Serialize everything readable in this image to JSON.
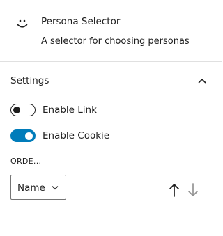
{
  "block": {
    "icon": "smiley-icon",
    "title": "Persona Selector",
    "description": "A selector for choosing personas"
  },
  "settings_panel": {
    "title": "Settings",
    "expanded": true,
    "toggles": [
      {
        "label": "Enable Link",
        "checked": false
      },
      {
        "label": "Enable Cookie",
        "checked": true
      }
    ],
    "order": {
      "label": "ORDE...",
      "selected": "Name"
    },
    "sort_icons": [
      "arrow-up-icon",
      "arrow-down-icon"
    ]
  },
  "colors": {
    "accent": "#007cba",
    "text": "#1e1e1e",
    "divider": "#e0e0e0",
    "muted_icon": "#949494"
  }
}
